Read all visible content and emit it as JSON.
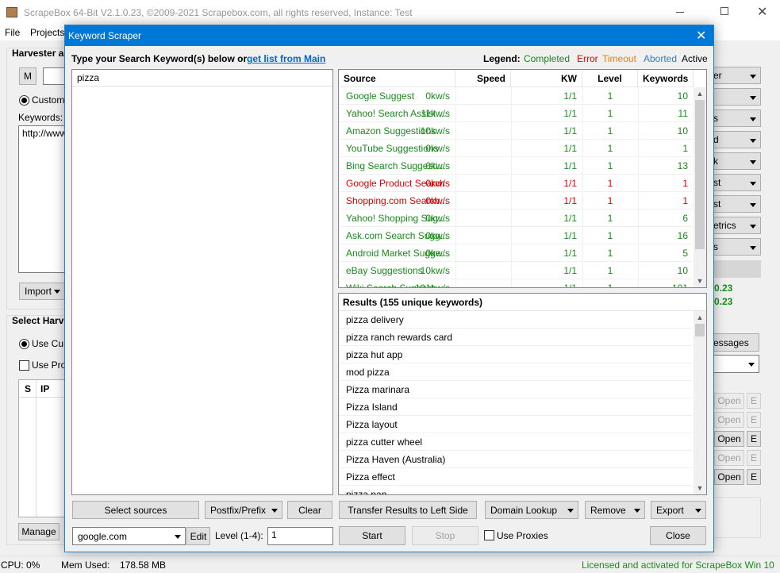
{
  "app": {
    "title": "ScrapeBox 64-Bit V2.1.0.23, ©2009-2021 Scrapebox.com, all rights reserved, Instance: Test",
    "menu": [
      "File",
      "Projects"
    ],
    "harvester_label": "Harvester a",
    "m_button": "M",
    "custom_radio": "Custom",
    "keywords_label": "Keywords:",
    "keywords_value": "http://www",
    "import_label": "Import",
    "select_harvester": "Select Harv",
    "use_custom": "Use Cu",
    "use_proxies": "Use Pro",
    "grid_cols": [
      "S",
      "IP"
    ],
    "manage_label": "Manage",
    "right_combos": [
      "er",
      "",
      "s",
      "d",
      "k",
      "st",
      "st",
      "etrics",
      "s"
    ],
    "right_stats": [
      "0.23",
      "0.23"
    ],
    "messages_btn": "essages",
    "open_label": "Open",
    "e_label": "E"
  },
  "status": {
    "cpu": "CPU:  0%",
    "mem_label": "Mem Used:",
    "mem_value": "178.58 MB",
    "license": "Licensed and activated for ScrapeBox Win 10"
  },
  "dialog": {
    "title": "Keyword Scraper",
    "instruction": "Type your Search Keyword(s) below or",
    "get_list_link": "get list from Main",
    "keywords_text": "pizza",
    "legend": {
      "label": "Legend:",
      "completed": "Completed",
      "error": "Error",
      "timeout": "Timeout",
      "aborted": "Aborted",
      "active": "Active"
    },
    "colors": {
      "completed": "#1a8a1a",
      "error": "#e00000",
      "timeout": "#f08000",
      "aborted": "#2a7fd0",
      "active": "#000000",
      "title_bar": "#0078d7"
    },
    "sources_headers": [
      "Source",
      "Speed",
      "KW",
      "Level",
      "Keywords"
    ],
    "sources": [
      {
        "name": "Google Suggest",
        "speed": "0kw/s",
        "kw": "1/1",
        "level": "1",
        "keywords": "10",
        "status": "completed"
      },
      {
        "name": "Yahoo! Search Assist ...",
        "speed": "11kw/s",
        "kw": "1/1",
        "level": "1",
        "keywords": "11",
        "status": "completed"
      },
      {
        "name": "Amazon Suggestions",
        "speed": "10kw/s",
        "kw": "1/1",
        "level": "1",
        "keywords": "10",
        "status": "completed"
      },
      {
        "name": "YouTube Suggestions",
        "speed": "0kw/s",
        "kw": "1/1",
        "level": "1",
        "keywords": "1",
        "status": "completed"
      },
      {
        "name": "Bing Search Suggesti...",
        "speed": "0kw/s",
        "kw": "1/1",
        "level": "1",
        "keywords": "13",
        "status": "completed"
      },
      {
        "name": "Google Product Search",
        "speed": "0kw/s",
        "kw": "1/1",
        "level": "1",
        "keywords": "1",
        "status": "error"
      },
      {
        "name": "Shopping.com Search...",
        "speed": "0kw/s",
        "kw": "1/1",
        "level": "1",
        "keywords": "1",
        "status": "error"
      },
      {
        "name": "Yahoo! Shopping Sug...",
        "speed": "0kw/s",
        "kw": "1/1",
        "level": "1",
        "keywords": "6",
        "status": "completed"
      },
      {
        "name": "Ask.com Search Sugg...",
        "speed": "0kw/s",
        "kw": "1/1",
        "level": "1",
        "keywords": "16",
        "status": "completed"
      },
      {
        "name": "Android Market Sugge...",
        "speed": "0kw/s",
        "kw": "1/1",
        "level": "1",
        "keywords": "5",
        "status": "completed"
      },
      {
        "name": "eBay Suggestions",
        "speed": "10kw/s",
        "kw": "1/1",
        "level": "1",
        "keywords": "10",
        "status": "completed"
      },
      {
        "name": "Wiki Search Suggest...",
        "speed": "101kw/s",
        "kw": "1/1",
        "level": "1",
        "keywords": "101",
        "status": "completed"
      }
    ],
    "results_header": "Results (155 unique keywords)",
    "results": [
      "pizza delivery",
      "pizza ranch rewards card",
      "pizza hut app",
      "mod pizza",
      "Pizza marinara",
      "Pizza Island",
      "Pizza layout",
      "pizza cutter wheel",
      "Pizza Haven (Australia)",
      "Pizza effect",
      "pizza pan"
    ],
    "buttons": {
      "select_sources": "Select sources",
      "postfix_prefix": "Postfix/Prefix",
      "clear": "Clear",
      "transfer": "Transfer Results to Left Side",
      "domain_lookup": "Domain Lookup",
      "remove": "Remove",
      "export": "Export",
      "edit": "Edit",
      "start": "Start",
      "stop": "Stop",
      "close": "Close"
    },
    "engine": "google.com",
    "level_label": "Level (1-4):",
    "level_value": "1",
    "use_proxies": "Use Proxies"
  }
}
